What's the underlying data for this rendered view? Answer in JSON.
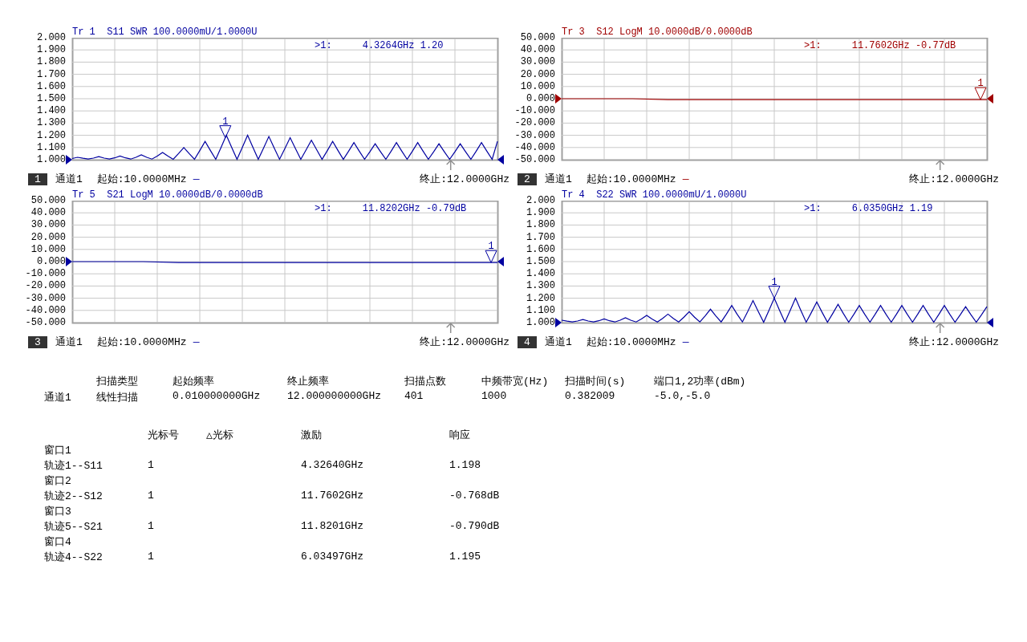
{
  "panels": [
    {
      "number": "1",
      "title": "Tr 1  S11 SWR 100.0000mU/1.0000U",
      "marker_id": ">1:",
      "marker_readout": "4.3264GHz 1.20",
      "marker_label": "1",
      "channel": "通道1",
      "start": "起始:10.0000MHz",
      "dash": "—",
      "stop": "终止:12.0000GHz",
      "chart_data": {
        "type": "line",
        "grid": true,
        "ylim": [
          1,
          2
        ],
        "yticks": [
          {
            "value": 2,
            "label": "2.000"
          },
          {
            "value": 1.9,
            "label": "1.900"
          },
          {
            "value": 1.8,
            "label": "1.800"
          },
          {
            "value": 1.7,
            "label": "1.700"
          },
          {
            "value": 1.6,
            "label": "1.600"
          },
          {
            "value": 1.5,
            "label": "1.500"
          },
          {
            "value": 1.4,
            "label": "1.400"
          },
          {
            "value": 1.3,
            "label": "1.300"
          },
          {
            "value": 1.2,
            "label": "1.200"
          },
          {
            "value": 1.1,
            "label": "1.100"
          },
          {
            "value": 1,
            "label": "1.000"
          }
        ],
        "categories": [
          null,
          null,
          null,
          null,
          null,
          null,
          null,
          null,
          null,
          null,
          null,
          null,
          null,
          null,
          null,
          null,
          null,
          null,
          null,
          null,
          null,
          null,
          null,
          null,
          null,
          null,
          null,
          null,
          null,
          null,
          null,
          null,
          null,
          null,
          null,
          null,
          null,
          null,
          null,
          null,
          null,
          null,
          null,
          null,
          null,
          null,
          null,
          null,
          null,
          null,
          null,
          null,
          null,
          null,
          null,
          null,
          null,
          null,
          null,
          null,
          null,
          null,
          null,
          null,
          null,
          null,
          null,
          null,
          null,
          null,
          null,
          null,
          null,
          null,
          null,
          null,
          null,
          null,
          null,
          null,
          null
        ],
        "series": [
          {
            "color": "#0000a0",
            "values": [
              1.01,
              1.02,
              1.012,
              1.005,
              1.013,
              1.025,
              1.013,
              1.005,
              1.015,
              1.03,
              1.015,
              1.005,
              1.02,
              1.04,
              1.02,
              1.005,
              1.03,
              1.06,
              1.03,
              1.003,
              1.05,
              1.1,
              1.05,
              1.003,
              1.075,
              1.15,
              1.075,
              1.003,
              1.1,
              1.2,
              1.1,
              1.003,
              1.1,
              1.2,
              1.1,
              1.003,
              1.095,
              1.19,
              1.095,
              1.003,
              1.09,
              1.18,
              1.09,
              1.003,
              1.08,
              1.16,
              1.08,
              1.003,
              1.075,
              1.15,
              1.075,
              1.003,
              1.07,
              1.14,
              1.07,
              1.003,
              1.065,
              1.13,
              1.065,
              1.003,
              1.07,
              1.14,
              1.07,
              1.003,
              1.07,
              1.14,
              1.07,
              1.003,
              1.065,
              1.13,
              1.065,
              1.003,
              1.065,
              1.13,
              1.065,
              1.003,
              1.07,
              1.14,
              1.07,
              1.003,
              1.15
            ]
          }
        ]
      }
    },
    {
      "number": "2",
      "title": "Tr 3  S12 LogM 10.0000dB/0.0000dB",
      "marker_id": ">1:",
      "marker_readout": "11.7602GHz -0.77dB",
      "marker_label": "1",
      "channel": "通道1",
      "start": "起始:10.0000MHz",
      "dash": "—",
      "stop": "终止:12.0000GHz",
      "chart_data": {
        "type": "line",
        "grid": true,
        "ylim": [
          -50,
          50
        ],
        "yticks": [
          {
            "value": 50,
            "label": "50.000"
          },
          {
            "value": 40,
            "label": "40.000"
          },
          {
            "value": 30,
            "label": "30.000"
          },
          {
            "value": 20,
            "label": "20.000"
          },
          {
            "value": 10,
            "label": "10.000"
          },
          {
            "value": 0,
            "label": "0.000"
          },
          {
            "value": -10,
            "label": "-10.000"
          },
          {
            "value": -20,
            "label": "-20.000"
          },
          {
            "value": -30,
            "label": "-30.000"
          },
          {
            "value": -40,
            "label": "-40.000"
          },
          {
            "value": -50,
            "label": "-50.000"
          }
        ],
        "categories": [
          null,
          null,
          null,
          null,
          null,
          null,
          null,
          null,
          null,
          null,
          null,
          null,
          null
        ],
        "series": [
          {
            "color": "#a00000",
            "values": [
              0,
              0,
              0,
              -0.77,
              -0.77,
              -0.77,
              -0.77,
              -0.77,
              -0.77,
              -0.77,
              -0.77,
              -0.77,
              -0.77
            ]
          }
        ]
      }
    },
    {
      "number": "3",
      "title": "Tr 5  S21 LogM 10.0000dB/0.0000dB",
      "marker_id": ">1:",
      "marker_readout": "11.8202GHz -0.79dB",
      "marker_label": "1",
      "channel": "通道1",
      "start": "起始:10.0000MHz",
      "dash": "—",
      "stop": "终止:12.0000GHz",
      "chart_data": {
        "type": "line",
        "grid": true,
        "ylim": [
          -50,
          50
        ],
        "yticks": [
          {
            "value": 50,
            "label": "50.000"
          },
          {
            "value": 40,
            "label": "40.000"
          },
          {
            "value": 30,
            "label": "30.000"
          },
          {
            "value": 20,
            "label": "20.000"
          },
          {
            "value": 10,
            "label": "10.000"
          },
          {
            "value": 0,
            "label": "0.000"
          },
          {
            "value": -10,
            "label": "-10.000"
          },
          {
            "value": -20,
            "label": "-20.000"
          },
          {
            "value": -30,
            "label": "-30.000"
          },
          {
            "value": -40,
            "label": "-40.000"
          },
          {
            "value": -50,
            "label": "-50.000"
          }
        ],
        "categories": [
          null,
          null,
          null,
          null,
          null,
          null,
          null,
          null,
          null,
          null,
          null,
          null,
          null
        ],
        "series": [
          {
            "color": "#0000a0",
            "values": [
              0,
              0,
              0,
              -0.79,
              -0.79,
              -0.79,
              -0.79,
              -0.79,
              -0.79,
              -0.79,
              -0.79,
              -0.79,
              -0.79
            ]
          }
        ]
      }
    },
    {
      "number": "4",
      "title": "Tr 4  S22 SWR 100.0000mU/1.0000U",
      "marker_id": ">1:",
      "marker_readout": "6.0350GHz 1.19",
      "marker_label": "1",
      "channel": "通道1",
      "start": "起始:10.0000MHz",
      "dash": "—",
      "stop": "终止:12.0000GHz",
      "chart_data": {
        "type": "line",
        "grid": true,
        "ylim": [
          1,
          2
        ],
        "yticks": [
          {
            "value": 2,
            "label": "2.000"
          },
          {
            "value": 1.9,
            "label": "1.900"
          },
          {
            "value": 1.8,
            "label": "1.800"
          },
          {
            "value": 1.7,
            "label": "1.700"
          },
          {
            "value": 1.6,
            "label": "1.600"
          },
          {
            "value": 1.5,
            "label": "1.500"
          },
          {
            "value": 1.4,
            "label": "1.400"
          },
          {
            "value": 1.3,
            "label": "1.300"
          },
          {
            "value": 1.2,
            "label": "1.200"
          },
          {
            "value": 1.1,
            "label": "1.100"
          },
          {
            "value": 1,
            "label": "1.000"
          }
        ],
        "categories": [
          null,
          null,
          null,
          null,
          null,
          null,
          null,
          null,
          null,
          null,
          null,
          null,
          null,
          null,
          null,
          null,
          null,
          null,
          null,
          null,
          null,
          null,
          null,
          null,
          null,
          null,
          null,
          null,
          null,
          null,
          null,
          null,
          null,
          null,
          null,
          null,
          null,
          null,
          null,
          null,
          null,
          null,
          null,
          null,
          null,
          null,
          null,
          null,
          null,
          null,
          null,
          null,
          null,
          null,
          null,
          null,
          null,
          null,
          null,
          null,
          null,
          null,
          null,
          null,
          null,
          null,
          null,
          null,
          null,
          null,
          null,
          null,
          null,
          null,
          null,
          null,
          null,
          null,
          null,
          null,
          null
        ],
        "series": [
          {
            "color": "#0000a0",
            "values": [
              1.02,
              1.012,
              1.005,
              1.013,
              1.025,
              1.013,
              1.005,
              1.015,
              1.03,
              1.015,
              1.005,
              1.02,
              1.04,
              1.02,
              1.005,
              1.03,
              1.06,
              1.03,
              1.005,
              1.035,
              1.07,
              1.035,
              1.005,
              1.045,
              1.09,
              1.045,
              1.005,
              1.055,
              1.11,
              1.055,
              1.005,
              1.07,
              1.14,
              1.07,
              1.005,
              1.09,
              1.18,
              1.09,
              1.003,
              1.1,
              1.2,
              1.1,
              1.003,
              1.1,
              1.2,
              1.1,
              1.003,
              1.085,
              1.17,
              1.085,
              1.003,
              1.075,
              1.15,
              1.075,
              1.003,
              1.07,
              1.14,
              1.07,
              1.003,
              1.07,
              1.14,
              1.07,
              1.003,
              1.07,
              1.14,
              1.07,
              1.003,
              1.07,
              1.14,
              1.07,
              1.003,
              1.07,
              1.14,
              1.07,
              1.003,
              1.065,
              1.13,
              1.065,
              1.003,
              1.065,
              1.13
            ]
          }
        ]
      }
    }
  ],
  "sweep_summary": {
    "columns": [
      "扫描类型",
      "起始频率",
      "终止频率",
      "扫描点数",
      "中频带宽(Hz)",
      "扫描时间(s)",
      "端口1,2功率(dBm)"
    ],
    "row": [
      "通道1",
      "线性扫描",
      "0.010000000GHz",
      "12.000000000GHz",
      "401",
      "1000",
      "0.382009",
      "-5.0,-5.0"
    ]
  },
  "marker_table": {
    "columns": [
      "光标号",
      "△光标",
      "激励",
      "响应"
    ],
    "groups": [
      {
        "window": "窗口1",
        "trace": "轨迹1--S11",
        "marker": "1",
        "stimulus": "4.32640GHz",
        "response": "1.198"
      },
      {
        "window": "窗口2",
        "trace": "轨迹2--S12",
        "marker": "1",
        "stimulus": "11.7602GHz",
        "response": "-0.768dB"
      },
      {
        "window": "窗口3",
        "trace": "轨迹5--S21",
        "marker": "1",
        "stimulus": "11.8201GHz",
        "response": "-0.790dB"
      },
      {
        "window": "窗口4",
        "trace": "轨迹4--S22",
        "marker": "1",
        "stimulus": "6.03497GHz",
        "response": "1.195"
      }
    ]
  }
}
